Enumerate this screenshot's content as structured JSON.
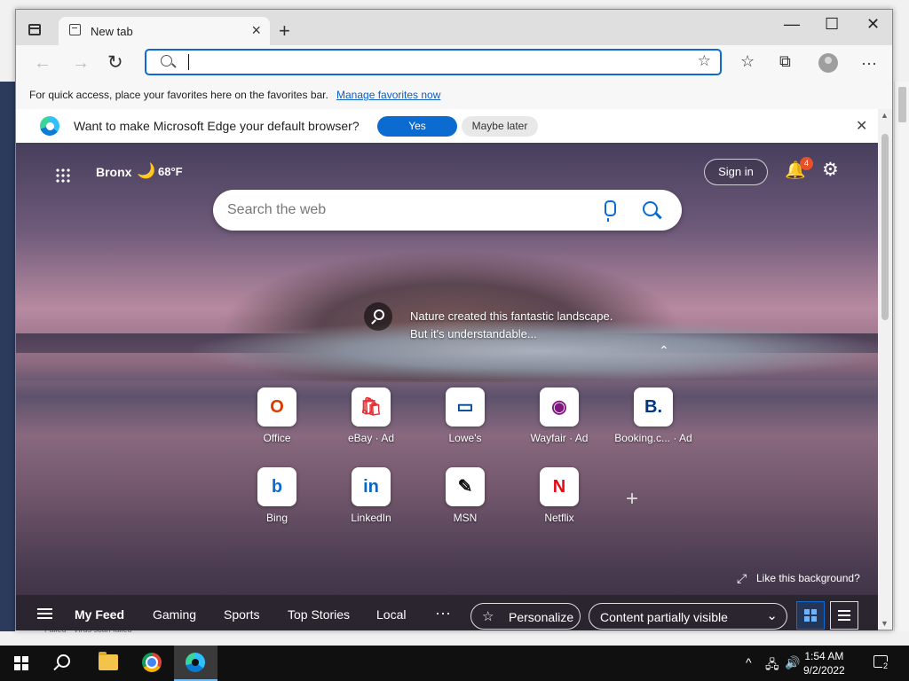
{
  "browser": {
    "tab_title": "New tab",
    "tab_close": "×",
    "new_tab": "+",
    "window_controls": {
      "minimize": "—",
      "maximize": "☐",
      "close": "✕"
    },
    "back_glyph": "←",
    "forward_glyph": "→",
    "refresh_glyph": "↻",
    "address_value": "",
    "more_glyph": "···",
    "favorites_bar_text": "For quick access, place your favorites here on the favorites bar.",
    "favorites_bar_link": "Manage favorites now",
    "favorites_star_glyph": "☆",
    "collections_glyph": "⧉"
  },
  "infobar": {
    "message": "Want to make Microsoft Edge your default browser?",
    "yes_label": "Yes",
    "later_label": "Maybe later",
    "close_glyph": "✕"
  },
  "newtab": {
    "weather_city": "Bronx",
    "weather_temp": "68°F",
    "weather_glyph": "🌙",
    "signin_label": "Sign in",
    "notifications_count": "4",
    "bell_glyph": "🔔",
    "gear_glyph": "⚙",
    "search_placeholder": "Search the web",
    "caption_line1": "Nature created this fantastic landscape.",
    "caption_line2": "But it's understandable...",
    "collapse_glyph": "⌃",
    "tiles": [
      {
        "label": "Office",
        "glyph": "O",
        "color": "#d83b01"
      },
      {
        "label": "eBay · Ad",
        "glyph": "🛍",
        "color": "#e53238"
      },
      {
        "label": "Lowe's",
        "glyph": "▭",
        "color": "#004990"
      },
      {
        "label": "Wayfair · Ad",
        "glyph": "◉",
        "color": "#7f187f"
      },
      {
        "label": "Booking.c... · Ad",
        "glyph": "B.",
        "color": "#003580"
      },
      {
        "label": "Bing",
        "glyph": "b",
        "color": "#0b6bd1"
      },
      {
        "label": "LinkedIn",
        "glyph": "in",
        "color": "#0a66c2"
      },
      {
        "label": "MSN",
        "glyph": "✎",
        "color": "#111111"
      },
      {
        "label": "Netflix",
        "glyph": "N",
        "color": "#e50914"
      }
    ],
    "add_tile_glyph": "+",
    "like_background": "Like this background?",
    "like_icon": "⤢"
  },
  "feed": {
    "items": [
      "My Feed",
      "Gaming",
      "Sports",
      "Top Stories",
      "Local"
    ],
    "more": "···",
    "personalize_label": "Personalize",
    "personalize_glyph": "☆",
    "content_visibility": "Content partially visible",
    "chevron_glyph": "⌄"
  },
  "desktop": {
    "bottom_text": "Failed • Virus scan failed"
  },
  "taskbar": {
    "time": "1:54 AM",
    "date": "9/2/2022",
    "tray_up": "^",
    "tray_network": "🖧",
    "tray_volume": "🔊",
    "notification_count": "2"
  },
  "colors": {
    "accent": "#0b6bd1",
    "badge": "#e8502a"
  }
}
